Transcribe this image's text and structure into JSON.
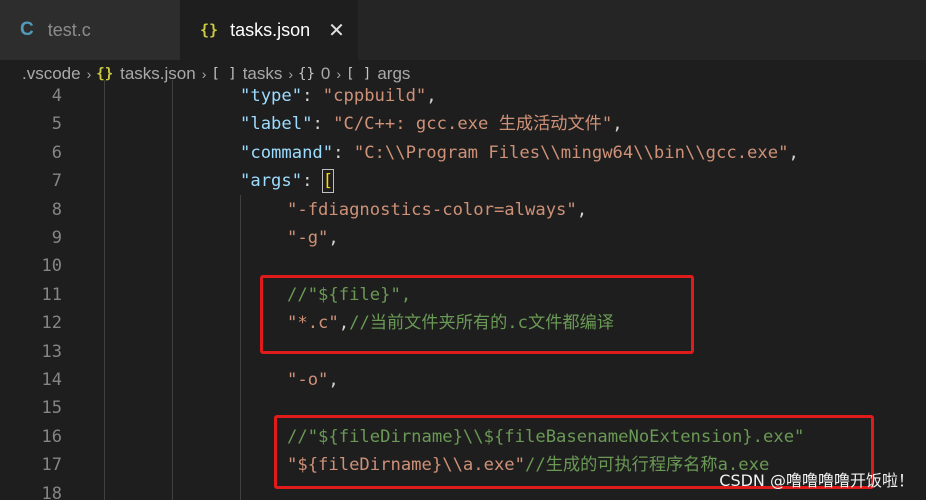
{
  "tabs": [
    {
      "icon": "C",
      "label": "test.c"
    },
    {
      "icon": "{}",
      "label": "tasks.json",
      "close": "✕"
    }
  ],
  "breadcrumb": {
    "folder": ".vscode",
    "sep": "›",
    "file_icon": "{}",
    "file": "tasks.json",
    "array_icon": "[ ]",
    "tasks": "tasks",
    "obj_icon": "{}",
    "index": "0",
    "args": "args"
  },
  "editor": {
    "lines": [
      {
        "no": "4",
        "parts": [
          {
            "t": "\"type\"",
            "c": "k"
          },
          {
            "t": ": ",
            "c": "p"
          },
          {
            "t": "\"cppbuild\"",
            "c": "s"
          },
          {
            "t": ",",
            "c": "p"
          }
        ]
      },
      {
        "no": "5",
        "parts": [
          {
            "t": "\"label\"",
            "c": "k"
          },
          {
            "t": ": ",
            "c": "p"
          },
          {
            "t": "\"C/C++: gcc.exe 生成活动文件\"",
            "c": "s"
          },
          {
            "t": ",",
            "c": "p"
          }
        ]
      },
      {
        "no": "6",
        "parts": [
          {
            "t": "\"command\"",
            "c": "k"
          },
          {
            "t": ": ",
            "c": "p"
          },
          {
            "t": "\"C:\\\\Program Files\\\\mingw64\\\\bin\\\\gcc.exe\"",
            "c": "s"
          },
          {
            "t": ",",
            "c": "p"
          }
        ]
      },
      {
        "no": "7",
        "parts": [
          {
            "t": "\"args\"",
            "c": "k"
          },
          {
            "t": ": ",
            "c": "p"
          },
          {
            "t": "[",
            "c": "br"
          }
        ]
      },
      {
        "no": "8",
        "parts": [
          {
            "t": "\"-fdiagnostics-color=always\"",
            "c": "s"
          },
          {
            "t": ",",
            "c": "p"
          }
        ]
      },
      {
        "no": "9",
        "parts": [
          {
            "t": "\"-g\"",
            "c": "s"
          },
          {
            "t": ",",
            "c": "p"
          }
        ]
      },
      {
        "no": "10",
        "parts": []
      },
      {
        "no": "11",
        "parts": [
          {
            "t": "//\"${file}\",",
            "c": "cm"
          }
        ]
      },
      {
        "no": "12",
        "parts": [
          {
            "t": "\"*.c\"",
            "c": "s"
          },
          {
            "t": ",",
            "c": "p"
          },
          {
            "t": "//当前文件夹所有的.c文件都编译",
            "c": "cm"
          }
        ]
      },
      {
        "no": "13",
        "parts": []
      },
      {
        "no": "14",
        "parts": [
          {
            "t": "\"-o\"",
            "c": "s"
          },
          {
            "t": ",",
            "c": "p"
          }
        ]
      },
      {
        "no": "15",
        "parts": []
      },
      {
        "no": "16",
        "parts": [
          {
            "t": "//\"${fileDirname}\\\\${fileBasenameNoExtension}.exe\"",
            "c": "cm"
          }
        ]
      },
      {
        "no": "17",
        "parts": [
          {
            "t": "\"${fileDirname}\\\\a.exe\"",
            "c": "s"
          },
          {
            "t": "//生成的可执行程序名称a.exe",
            "c": "cm"
          }
        ]
      },
      {
        "no": "18",
        "parts": []
      }
    ]
  },
  "watermark": "CSDN @噜噜噜噜开饭啦！",
  "colors": {
    "background": "#1e1e1e",
    "key": "#9cdcfe",
    "string": "#ce9178",
    "comment": "#6a9955",
    "highlight_box": "#e01b1b"
  }
}
